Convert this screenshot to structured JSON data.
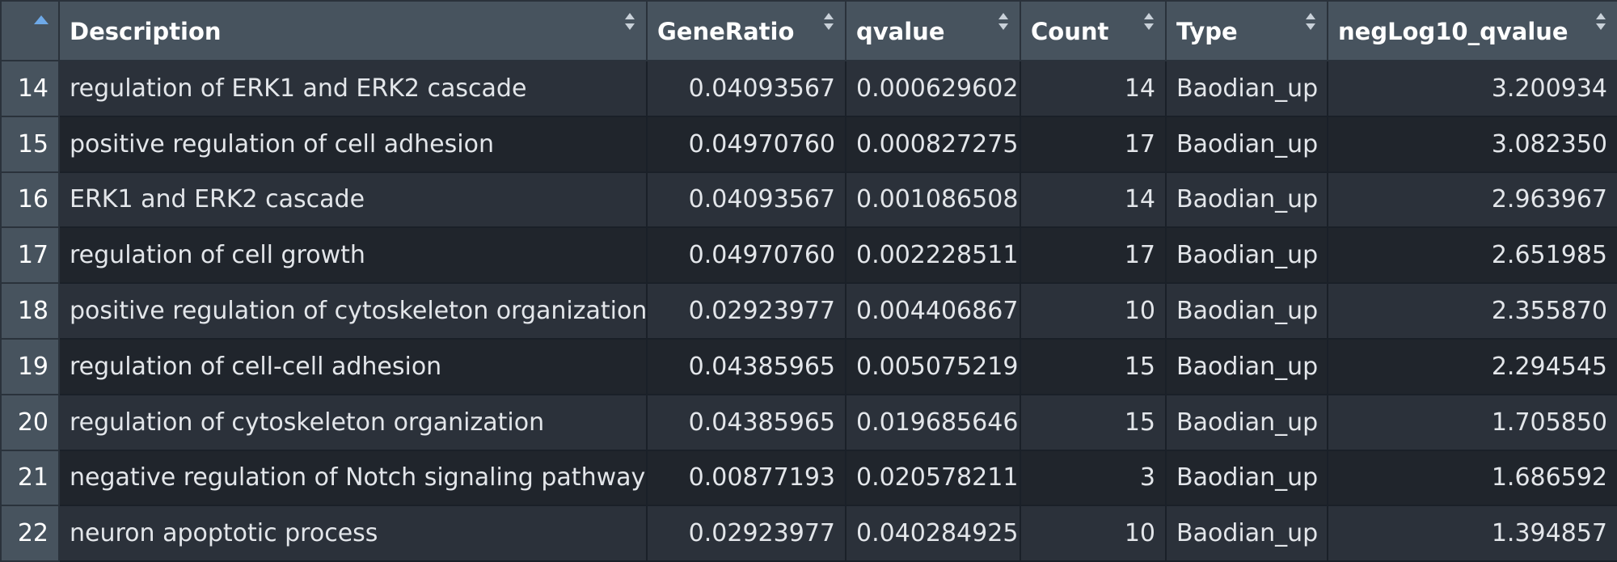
{
  "table": {
    "columns": [
      {
        "label": ""
      },
      {
        "label": "Description"
      },
      {
        "label": "GeneRatio"
      },
      {
        "label": "qvalue"
      },
      {
        "label": "Count"
      },
      {
        "label": "Type"
      },
      {
        "label": "negLog10_qvalue"
      }
    ],
    "rows": [
      {
        "idx": "14",
        "description": "regulation of ERK1 and ERK2 cascade",
        "gene_ratio": "0.04093567",
        "qvalue": "0.000629602",
        "count": "14",
        "type": "Baodian_up",
        "neglog10_qvalue": "3.200934"
      },
      {
        "idx": "15",
        "description": "positive regulation of cell adhesion",
        "gene_ratio": "0.04970760",
        "qvalue": "0.000827275",
        "count": "17",
        "type": "Baodian_up",
        "neglog10_qvalue": "3.082350"
      },
      {
        "idx": "16",
        "description": "ERK1 and ERK2 cascade",
        "gene_ratio": "0.04093567",
        "qvalue": "0.001086508",
        "count": "14",
        "type": "Baodian_up",
        "neglog10_qvalue": "2.963967"
      },
      {
        "idx": "17",
        "description": "regulation of cell growth",
        "gene_ratio": "0.04970760",
        "qvalue": "0.002228511",
        "count": "17",
        "type": "Baodian_up",
        "neglog10_qvalue": "2.651985"
      },
      {
        "idx": "18",
        "description": "positive regulation of cytoskeleton organization",
        "gene_ratio": "0.02923977",
        "qvalue": "0.004406867",
        "count": "10",
        "type": "Baodian_up",
        "neglog10_qvalue": "2.355870"
      },
      {
        "idx": "19",
        "description": "regulation of cell-cell adhesion",
        "gene_ratio": "0.04385965",
        "qvalue": "0.005075219",
        "count": "15",
        "type": "Baodian_up",
        "neglog10_qvalue": "2.294545"
      },
      {
        "idx": "20",
        "description": "regulation of cytoskeleton organization",
        "gene_ratio": "0.04385965",
        "qvalue": "0.019685646",
        "count": "15",
        "type": "Baodian_up",
        "neglog10_qvalue": "1.705850"
      },
      {
        "idx": "21",
        "description": "negative regulation of Notch signaling pathway",
        "gene_ratio": "0.00877193",
        "qvalue": "0.020578211",
        "count": "3",
        "type": "Baodian_up",
        "neglog10_qvalue": "1.686592"
      },
      {
        "idx": "22",
        "description": "neuron apoptotic process",
        "gene_ratio": "0.02923977",
        "qvalue": "0.040284925",
        "count": "10",
        "type": "Baodian_up",
        "neglog10_qvalue": "1.394857"
      }
    ]
  }
}
